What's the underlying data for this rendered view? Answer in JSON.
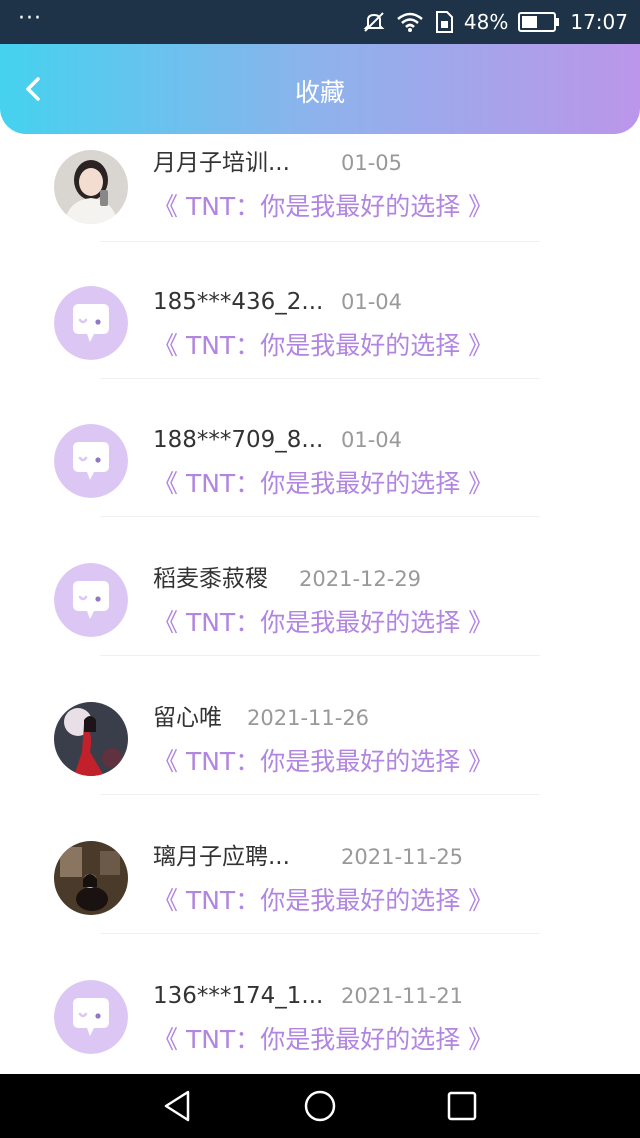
{
  "status_bar": {
    "battery": "48%",
    "time": "17:07",
    "menu_dots": "···"
  },
  "header": {
    "title": "收藏",
    "back_icon": "chevron-left-icon"
  },
  "items": [
    {
      "name": "月月子培训...",
      "date": "01-05",
      "subtitle": "《 TNT：你是我最好的选择 》",
      "avatar": "photo-woman"
    },
    {
      "name": "185***436_2...",
      "date": "01-04",
      "subtitle": "《 TNT：你是我最好的选择 》",
      "avatar": "default-chat-avatar"
    },
    {
      "name": "188***709_8...",
      "date": "01-04",
      "subtitle": "《 TNT：你是我最好的选择 》",
      "avatar": "default-chat-avatar"
    },
    {
      "name": "稻麦黍菽稷",
      "date": "2021-12-29",
      "subtitle": "《 TNT：你是我最好的选择 》",
      "avatar": "default-chat-avatar"
    },
    {
      "name": "留心唯",
      "date": "2021-11-26",
      "subtitle": "《 TNT：你是我最好的选择 》",
      "avatar": "photo-red-dress"
    },
    {
      "name": "璃月子应聘...",
      "date": "2021-11-25",
      "subtitle": "《 TNT：你是我最好的选择 》",
      "avatar": "photo-dark-room"
    },
    {
      "name": "136***174_1...",
      "date": "2021-11-21",
      "subtitle": "《 TNT：你是我最好的选择 》",
      "avatar": "default-chat-avatar"
    }
  ],
  "colors": {
    "accent": "#b185e0",
    "avatar_bg": "#dcc7f4",
    "header_start": "#45d2ef",
    "header_end": "#bc96ea"
  }
}
